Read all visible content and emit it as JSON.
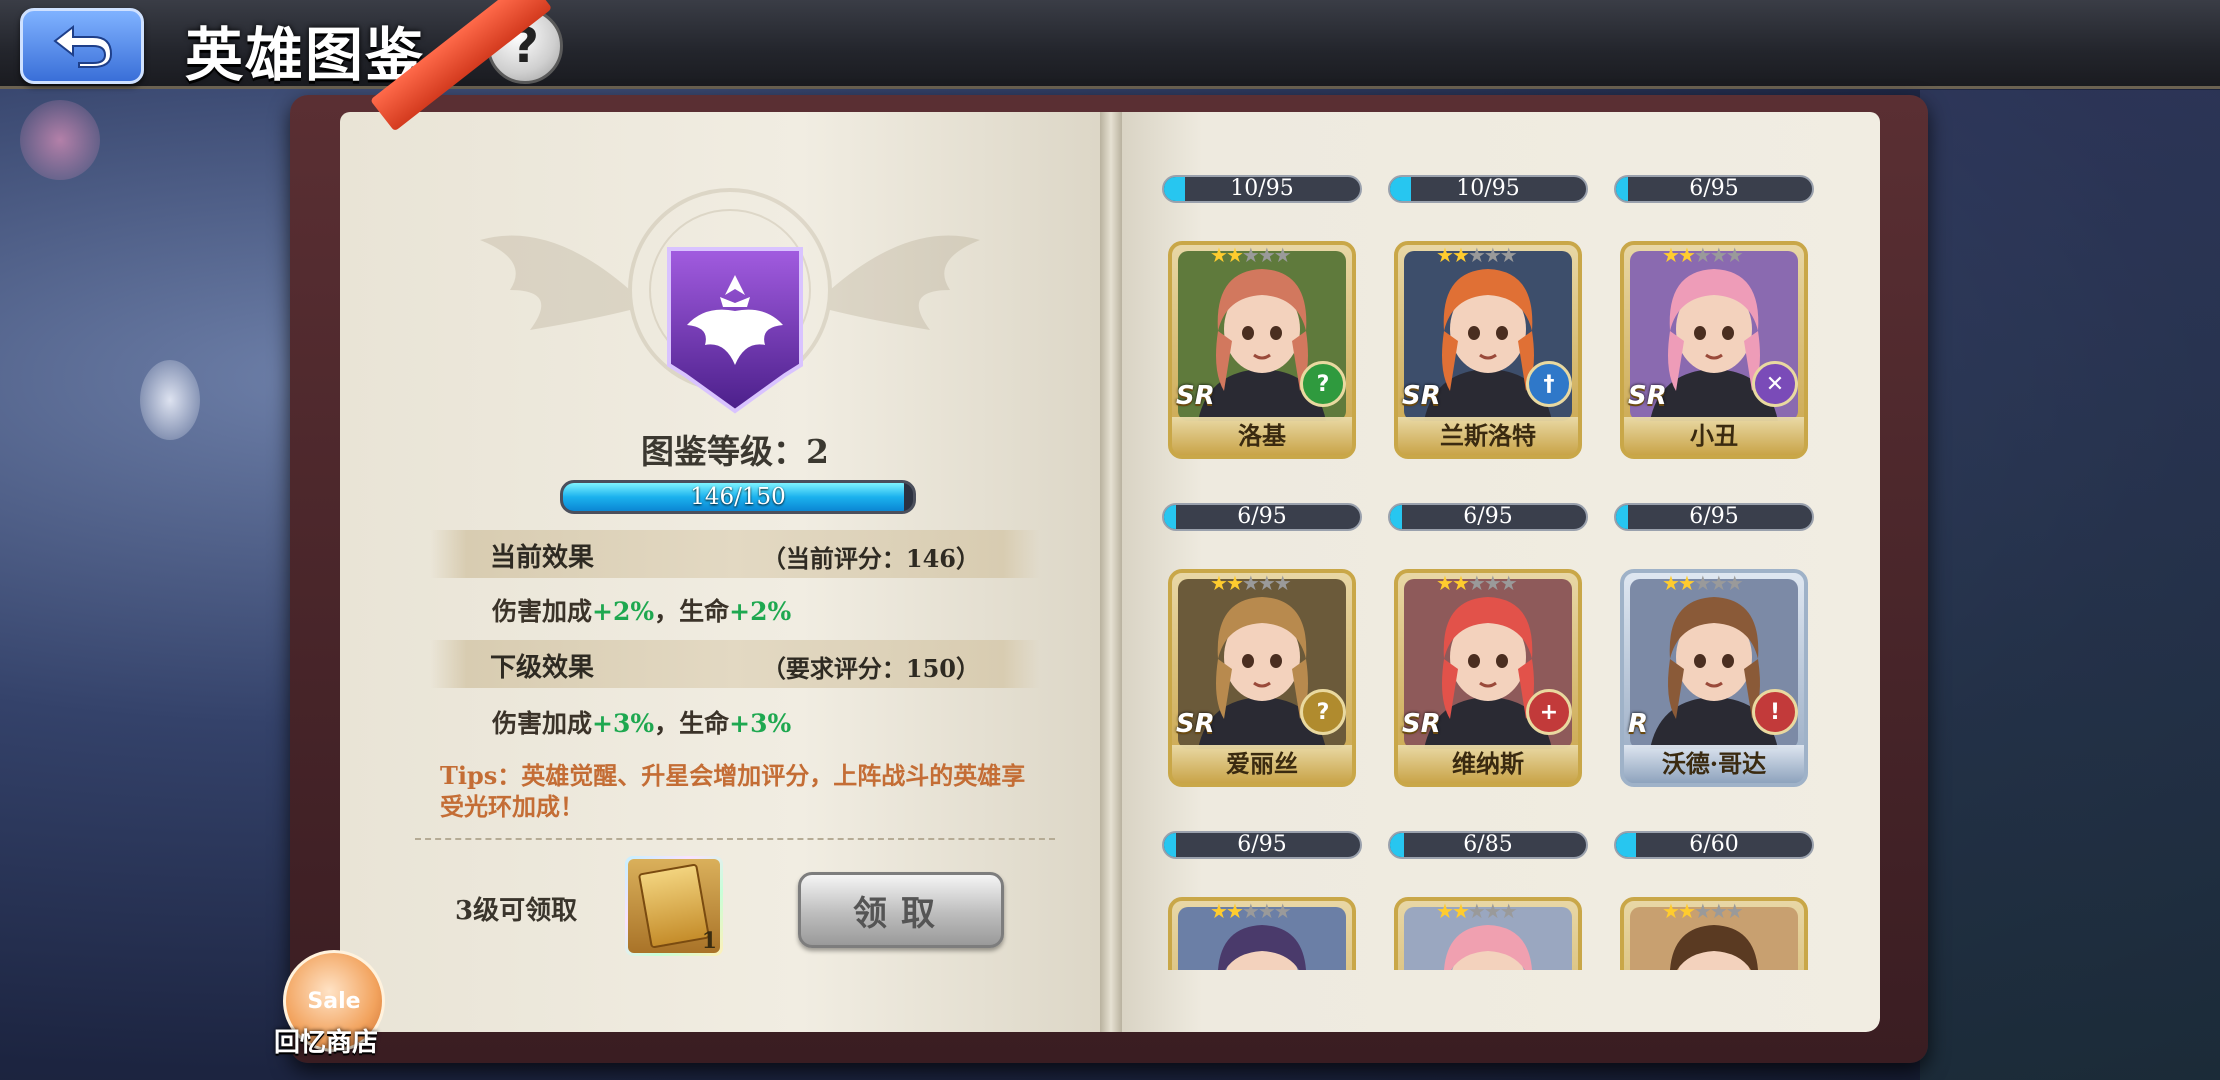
{
  "header": {
    "title": "英雄图鉴",
    "help_label": "?"
  },
  "codex": {
    "level_label": "图鉴等级：2",
    "progress_text": "146/150",
    "progress_value": 146,
    "progress_max": 150
  },
  "current_effect": {
    "title": "当前效果",
    "score": "（当前评分：146）",
    "dmg_label": "伤害加成",
    "dmg_value": "+2%",
    "sep": "，生命",
    "hp_value": "+2%"
  },
  "next_effect": {
    "title": "下级效果",
    "score": "（要求评分：150）",
    "dmg_label": "伤害加成",
    "dmg_value": "+3%",
    "sep": "，生命",
    "hp_value": "+3%"
  },
  "tips": "Tips：英雄觉醒、升星会增加评分，上阵战斗的英雄享受光环加成！",
  "reward": {
    "label": "3级可领取",
    "count": "1",
    "button": "领取"
  },
  "shop": {
    "badge": "Sale",
    "label": "回忆商店"
  },
  "heroes": [
    {
      "name": "洛基",
      "rarity": "SR",
      "stars": 2,
      "progress": "10/95",
      "value": 10,
      "max": 95,
      "class_color": "#2f9a3e",
      "class_icon": "question-icon",
      "hair": "#d2785e",
      "bg": "#5f7a3c"
    },
    {
      "name": "兰斯洛特",
      "rarity": "SR",
      "stars": 2,
      "progress": "10/95",
      "value": 10,
      "max": 95,
      "class_color": "#2f78c9",
      "class_icon": "sword-icon",
      "hair": "#e07035",
      "bg": "#3d4e6b"
    },
    {
      "name": "小丑",
      "rarity": "SR",
      "stars": 2,
      "progress": "6/95",
      "value": 6,
      "max": 95,
      "class_color": "#7a4bb8",
      "class_icon": "crossed-swords-icon",
      "hair": "#ee9cb8",
      "bg": "#8a6ab0"
    },
    {
      "name": "爱丽丝",
      "rarity": "SR",
      "stars": 2,
      "progress": "6/95",
      "value": 6,
      "max": 95,
      "class_color": "#b08b2e",
      "class_icon": "question-icon",
      "hair": "#b88a4e",
      "bg": "#6b5a3a"
    },
    {
      "name": "维纳斯",
      "rarity": "SR",
      "stars": 2,
      "progress": "6/95",
      "value": 6,
      "max": 95,
      "class_color": "#c23a3a",
      "class_icon": "cross-icon",
      "hair": "#e2524a",
      "bg": "#8e5a5a"
    },
    {
      "name": "沃德·哥达",
      "rarity": "R",
      "stars": 2,
      "progress": "6/95",
      "value": 6,
      "max": 95,
      "class_color": "#c23a3a",
      "class_icon": "shield-icon",
      "hair": "#8a5a38",
      "bg": "#7c8aa6"
    },
    {
      "name": "",
      "rarity": "",
      "stars": 2,
      "progress": "6/95",
      "value": 6,
      "max": 95,
      "class_color": "#2f78c9",
      "class_icon": "",
      "hair": "#4a3a6b",
      "bg": "#6b7fa6"
    },
    {
      "name": "",
      "rarity": "",
      "stars": 2,
      "progress": "6/85",
      "value": 6,
      "max": 85,
      "class_color": "#2f78c9",
      "class_icon": "",
      "hair": "#f0a0b0",
      "bg": "#9aa7c0"
    },
    {
      "name": "",
      "rarity": "",
      "stars": 2,
      "progress": "6/60",
      "value": 6,
      "max": 60,
      "class_color": "#2f78c9",
      "class_icon": "",
      "hair": "#5a3a22",
      "bg": "#c8a070"
    }
  ]
}
